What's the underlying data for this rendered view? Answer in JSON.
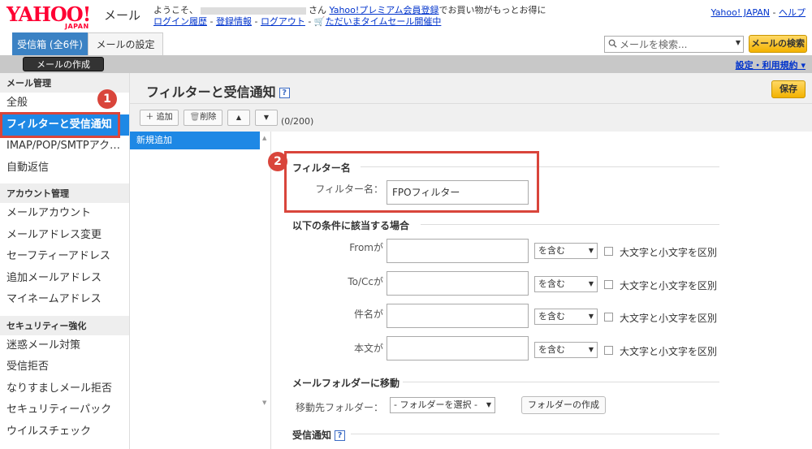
{
  "header": {
    "logo_text": "YAHOO!",
    "logo_sub": "JAPAN",
    "service": "メール",
    "welcome_prefix": "ようこそ、",
    "welcome_suffix": "さん",
    "premium_link": "Yahoo!プレミアム会員登録",
    "premium_tail": "でお買い物がもっとお得に",
    "login_history": "ログイン履歴",
    "registration": "登録情報",
    "logout": "ログアウト",
    "sale_link": "ただいまタイムセール開催中",
    "sep": " - ",
    "top_links": [
      "Yahoo! JAPAN",
      "ヘルプ"
    ]
  },
  "tabs": {
    "inbox": "受信箱 (全6件)",
    "settings": "メールの設定"
  },
  "search": {
    "placeholder": "メールを検索...",
    "button": "メールの検索"
  },
  "graybar": {
    "compose": "メールの作成",
    "settings_link": "設定・利用規約"
  },
  "sidebar": {
    "sections": [
      {
        "title": "メール管理",
        "items": [
          "全般",
          "フィルターと受信通知",
          "IMAP/POP/SMTPアク…",
          "自動返信"
        ]
      },
      {
        "title": "アカウント管理",
        "items": [
          "メールアカウント",
          "メールアドレス変更",
          "セーフティーアドレス",
          "追加メールアドレス",
          "マイネームアドレス"
        ]
      },
      {
        "title": "セキュリティー強化",
        "items": [
          "迷惑メール対策",
          "受信拒否",
          "なりすましメール拒否",
          "セキュリティーパック",
          "ウイルスチェック"
        ]
      }
    ],
    "active": "フィルターと受信通知"
  },
  "main": {
    "title": "フィルターと受信通知",
    "help": "?",
    "save": "保存",
    "toolbar": {
      "add": "追加",
      "delete": "削除",
      "up": "▲",
      "down": "▼",
      "count": "(0/200)"
    },
    "filter_list": [
      "新規追加"
    ],
    "filter_name_section": "フィルター名",
    "filter_name_label": "フィルター名：",
    "filter_name_value": "FPOフィルター",
    "conditions_section": "以下の条件に該当する場合",
    "conditions": [
      {
        "label": "Fromが",
        "match": "を含む",
        "case": "大文字と小文字を区別"
      },
      {
        "label": "To/Ccが",
        "match": "を含む",
        "case": "大文字と小文字を区別"
      },
      {
        "label": "件名が",
        "match": "を含む",
        "case": "大文字と小文字を区別"
      },
      {
        "label": "本文が",
        "match": "を含む",
        "case": "大文字と小文字を区別"
      }
    ],
    "move_section": "メールフォルダーに移動",
    "move_label": "移動先フォルダー：",
    "folder_select": "- フォルダーを選択 -",
    "folder_create": "フォルダーの作成",
    "notify_section": "受信通知"
  },
  "annotations": {
    "badge1": "1",
    "badge2": "2"
  },
  "colors": {
    "accent": "#1e88e5",
    "highlight": "#d9453b",
    "brand": "#ff0033",
    "button_yellow": "#f3b200"
  }
}
